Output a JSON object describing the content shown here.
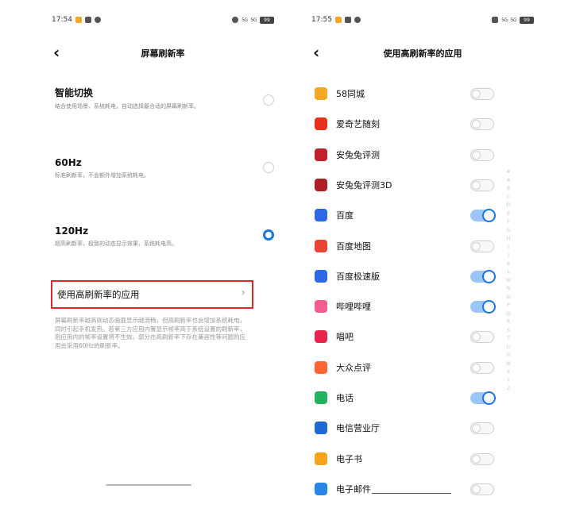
{
  "left": {
    "status": {
      "time": "17:54",
      "battery": "99",
      "signal": "5G"
    },
    "title": "屏幕刷新率",
    "options": [
      {
        "title": "智能切换",
        "desc": "结合使用场景、系统耗电，自动选择最合适的屏幕刷新率。",
        "selected": false
      },
      {
        "title": "60Hz",
        "desc": "标准刷新率，不会额外增加系统耗电。",
        "selected": false
      },
      {
        "title": "120Hz",
        "desc": "超高刷新率，极致的动态显示效果，系统耗电高。",
        "selected": true
      }
    ],
    "link_label": "使用高刷新率的应用",
    "note": "屏幕刷新率越高则动态画面显示越流畅，但高刷新率也会增加系统耗电，同时引起手机发热。若第三方应用内置显示帧率高于系统设置的刷新率，则应用内的帧率设置将不生效。部分在高刷新率下存在兼容性等问题的应用会采用60Hz的刷新率。"
  },
  "right": {
    "status": {
      "time": "17:55",
      "battery": "99",
      "signal": "5G"
    },
    "title": "使用高刷新率的应用",
    "apps": [
      {
        "name": "58同城",
        "icon": "58-tongcheng-icon",
        "color": "#f5a623",
        "on": false
      },
      {
        "name": "爱奇艺随刻",
        "icon": "iqiyi-suike-icon",
        "color": "#e8321d",
        "on": false
      },
      {
        "name": "安兔兔评测",
        "icon": "antutu-icon",
        "color": "#c0232b",
        "on": false
      },
      {
        "name": "安兔兔评测3D",
        "icon": "antutu-3d-icon",
        "color": "#b01e25",
        "on": false
      },
      {
        "name": "百度",
        "icon": "baidu-icon",
        "color": "#2e66e6",
        "on": true
      },
      {
        "name": "百度地图",
        "icon": "baidu-map-icon",
        "color": "#e94335",
        "on": false
      },
      {
        "name": "百度极速版",
        "icon": "baidu-lite-icon",
        "color": "#2e66e6",
        "on": true
      },
      {
        "name": "哔哩哔哩",
        "icon": "bilibili-icon",
        "color": "#f25d8e",
        "on": true
      },
      {
        "name": "唱吧",
        "icon": "changba-icon",
        "color": "#e6254f",
        "on": false
      },
      {
        "name": "大众点评",
        "icon": "dianping-icon",
        "color": "#ff6633",
        "on": false
      },
      {
        "name": "电话",
        "icon": "phone-icon",
        "color": "#22b35e",
        "on": true
      },
      {
        "name": "电信营业厅",
        "icon": "telecom-icon",
        "color": "#1f67d2",
        "on": false
      },
      {
        "name": "电子书",
        "icon": "ebook-icon",
        "color": "#f5a31a",
        "on": false
      },
      {
        "name": "电子邮件",
        "icon": "email-icon",
        "color": "#2a86e6",
        "on": false
      }
    ],
    "index_letters": [
      "#",
      "A",
      "B",
      "C",
      "D",
      "E",
      "F",
      "G",
      "H",
      "I",
      "J",
      "K",
      "L",
      "M",
      "N",
      "O",
      "P",
      "Q",
      "R",
      "S",
      "T",
      "U",
      "V",
      "W",
      "X",
      "Y",
      "Z"
    ]
  },
  "colors": {
    "accent": "#1a73e8",
    "highlight_box": "#e2262c"
  }
}
